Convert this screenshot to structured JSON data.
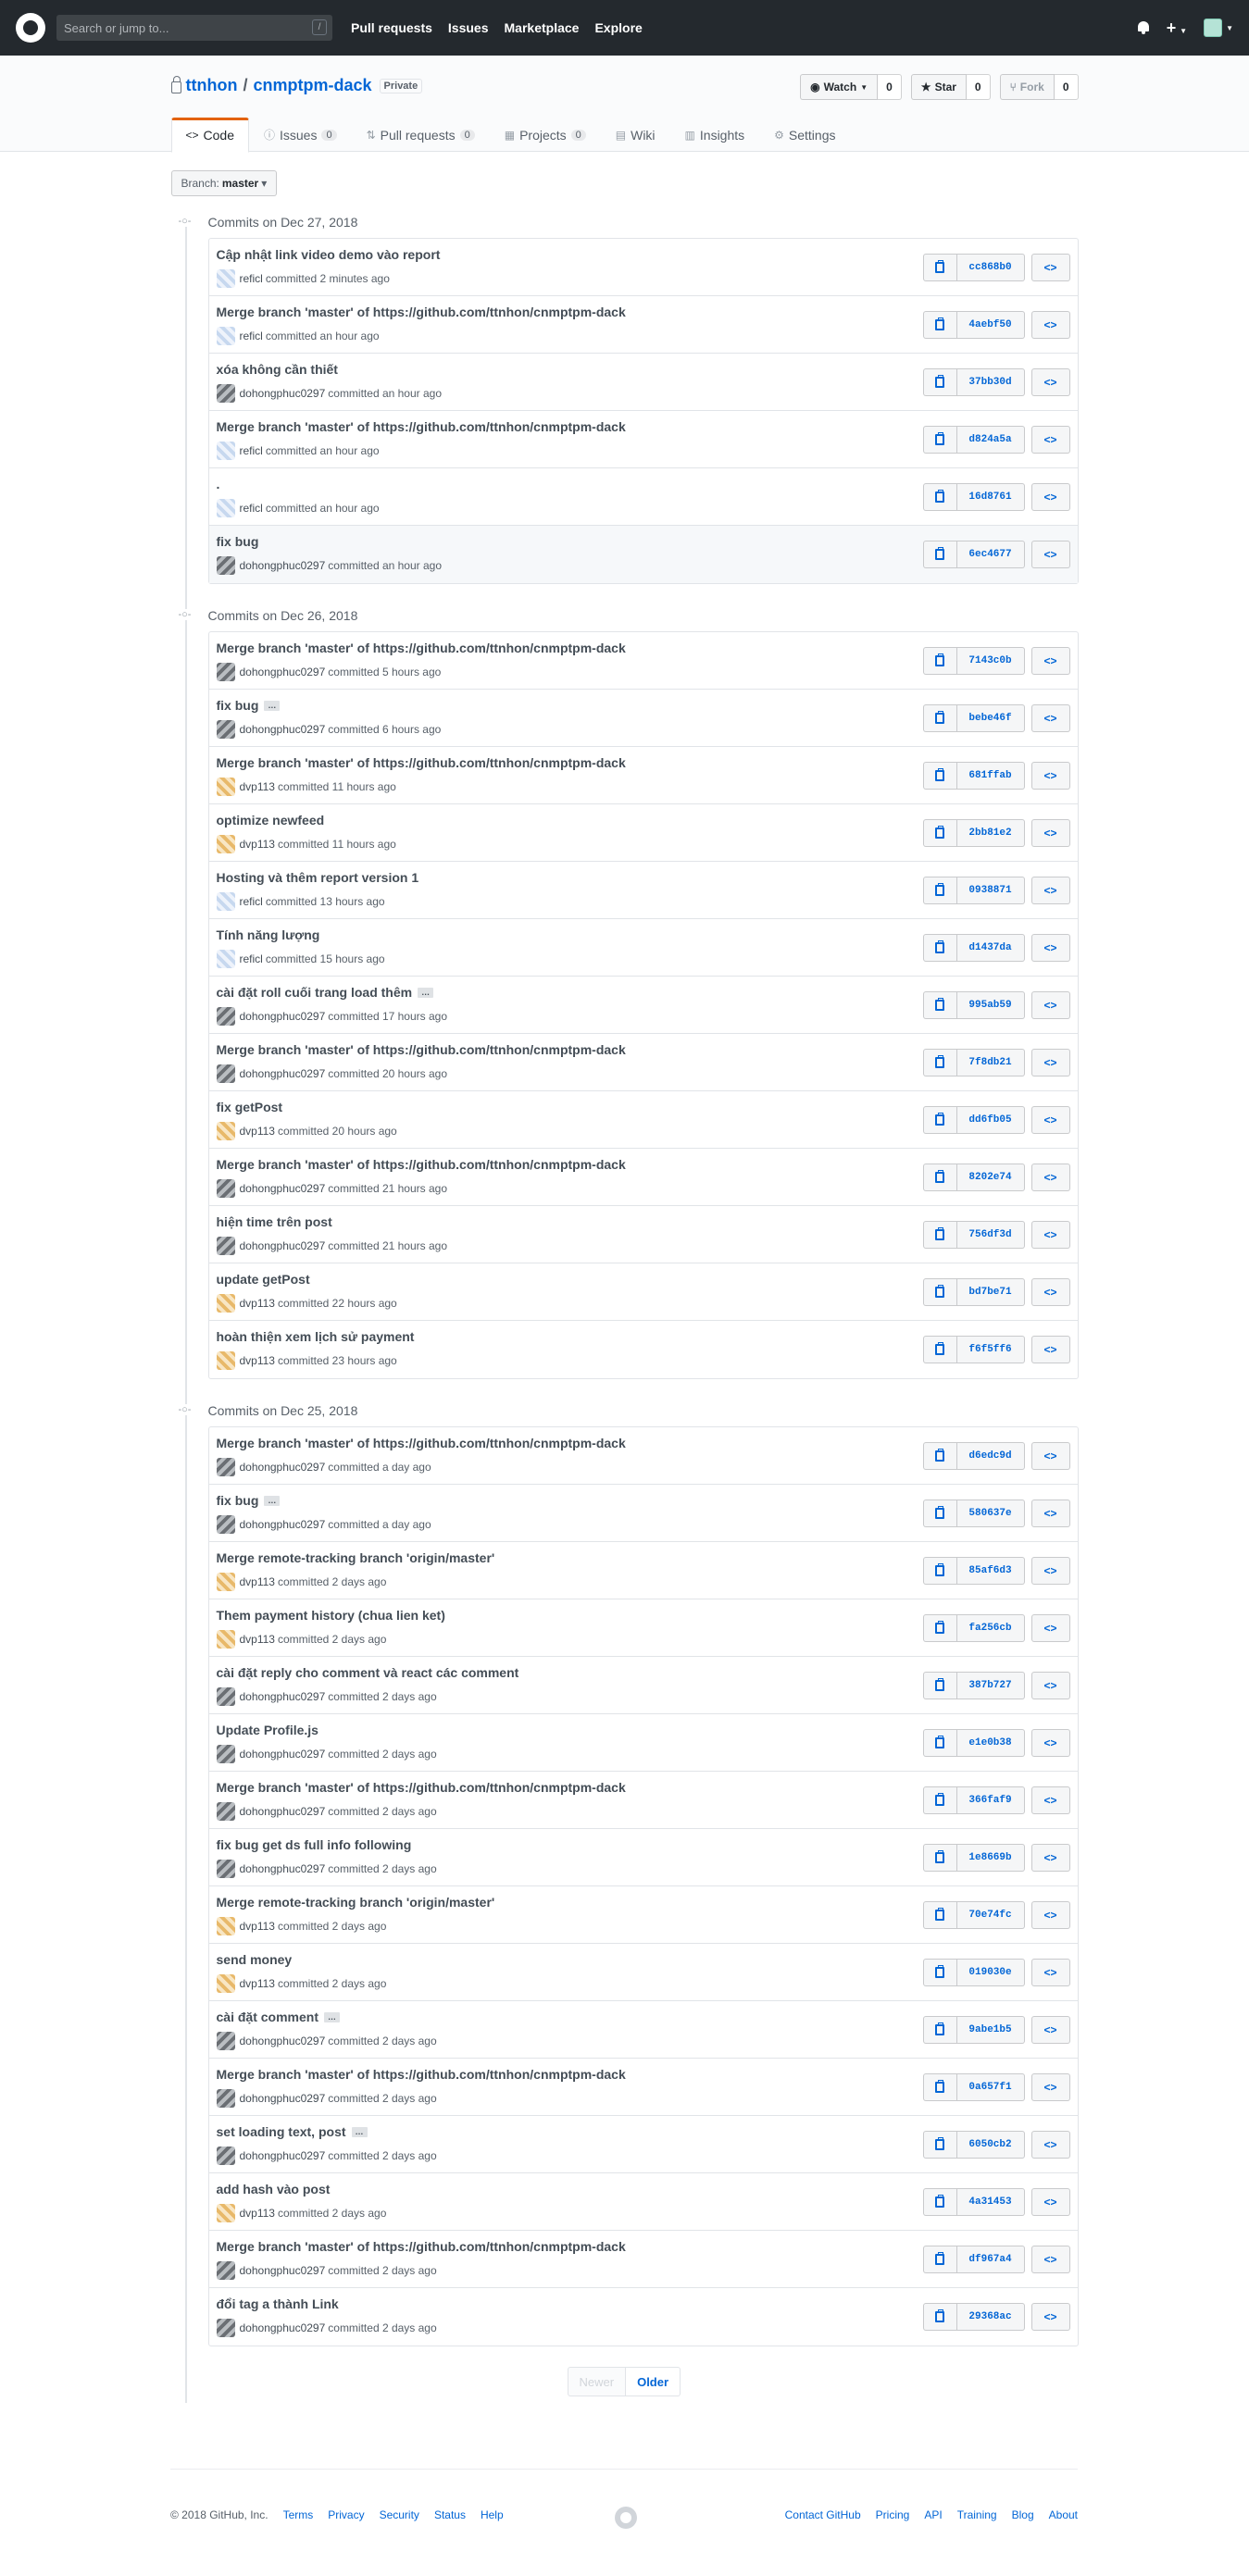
{
  "header": {
    "search_placeholder": "Search or jump to...",
    "search_key": "/",
    "nav": [
      "Pull requests",
      "Issues",
      "Marketplace",
      "Explore"
    ]
  },
  "repo": {
    "owner": "ttnhon",
    "separator": "/",
    "name": "cnmptpm-dack",
    "visibility": "Private",
    "watch_label": "Watch",
    "watch_count": "0",
    "star_label": "Star",
    "star_count": "0",
    "fork_label": "Fork",
    "fork_count": "0",
    "tabs": [
      {
        "label": "Code",
        "counter": null,
        "icon": "<>"
      },
      {
        "label": "Issues",
        "counter": "0",
        "icon": "ⓘ"
      },
      {
        "label": "Pull requests",
        "counter": "0",
        "icon": "⇅"
      },
      {
        "label": "Projects",
        "counter": "0",
        "icon": "▦"
      },
      {
        "label": "Wiki",
        "counter": null,
        "icon": "▤"
      },
      {
        "label": "Insights",
        "counter": null,
        "icon": "▥"
      },
      {
        "label": "Settings",
        "counter": null,
        "icon": "⚙"
      }
    ]
  },
  "branch": {
    "prefix": "Branch:",
    "name": "master"
  },
  "groups": [
    {
      "title": "Commits on Dec 27, 2018",
      "commits": [
        {
          "msg": "Cập nhật link video demo vào report",
          "author": "reficl",
          "time": "committed 2 minutes ago",
          "sha": "cc868b0",
          "av": "a",
          "more": false
        },
        {
          "msg": "Merge branch 'master' of https://github.com/ttnhon/cnmptpm-dack",
          "author": "reficl",
          "time": "committed an hour ago",
          "sha": "4aebf50",
          "av": "a",
          "more": false
        },
        {
          "msg": "xóa không cần thiết",
          "author": "dohongphuc0297",
          "time": "committed an hour ago",
          "sha": "37bb30d",
          "av": "b",
          "more": false
        },
        {
          "msg": "Merge branch 'master' of https://github.com/ttnhon/cnmptpm-dack",
          "author": "reficl",
          "time": "committed an hour ago",
          "sha": "d824a5a",
          "av": "a",
          "more": false
        },
        {
          "msg": ".",
          "author": "reficl",
          "time": "committed an hour ago",
          "sha": "16d8761",
          "av": "a",
          "more": false
        },
        {
          "msg": "fix bug",
          "author": "dohongphuc0297",
          "time": "committed an hour ago",
          "sha": "6ec4677",
          "av": "b",
          "more": false
        }
      ]
    },
    {
      "title": "Commits on Dec 26, 2018",
      "commits": [
        {
          "msg": "Merge branch 'master' of https://github.com/ttnhon/cnmptpm-dack",
          "author": "dohongphuc0297",
          "time": "committed 5 hours ago",
          "sha": "7143c0b",
          "av": "b",
          "more": false
        },
        {
          "msg": "fix bug",
          "author": "dohongphuc0297",
          "time": "committed 6 hours ago",
          "sha": "bebe46f",
          "av": "b",
          "more": true
        },
        {
          "msg": "Merge branch 'master' of https://github.com/ttnhon/cnmptpm-dack",
          "author": "dvp113",
          "time": "committed 11 hours ago",
          "sha": "681ffab",
          "av": "c",
          "more": false
        },
        {
          "msg": "optimize newfeed",
          "author": "dvp113",
          "time": "committed 11 hours ago",
          "sha": "2bb81e2",
          "av": "c",
          "more": false
        },
        {
          "msg": "Hosting và thêm report version 1",
          "author": "reficl",
          "time": "committed 13 hours ago",
          "sha": "0938871",
          "av": "a",
          "more": false
        },
        {
          "msg": "Tính năng lượng",
          "author": "reficl",
          "time": "committed 15 hours ago",
          "sha": "d1437da",
          "av": "a",
          "more": false
        },
        {
          "msg": "cài đặt roll cuối trang load thêm",
          "author": "dohongphuc0297",
          "time": "committed 17 hours ago",
          "sha": "995ab59",
          "av": "b",
          "more": true
        },
        {
          "msg": "Merge branch 'master' of https://github.com/ttnhon/cnmptpm-dack",
          "author": "dohongphuc0297",
          "time": "committed 20 hours ago",
          "sha": "7f8db21",
          "av": "b",
          "more": false
        },
        {
          "msg": "fix getPost",
          "author": "dvp113",
          "time": "committed 20 hours ago",
          "sha": "dd6fb05",
          "av": "c",
          "more": false
        },
        {
          "msg": "Merge branch 'master' of https://github.com/ttnhon/cnmptpm-dack",
          "author": "dohongphuc0297",
          "time": "committed 21 hours ago",
          "sha": "8202e74",
          "av": "b",
          "more": false
        },
        {
          "msg": "hiện time trên post",
          "author": "dohongphuc0297",
          "time": "committed 21 hours ago",
          "sha": "756df3d",
          "av": "b",
          "more": false
        },
        {
          "msg": "update getPost",
          "author": "dvp113",
          "time": "committed 22 hours ago",
          "sha": "bd7be71",
          "av": "c",
          "more": false
        },
        {
          "msg": "hoàn thiện xem lịch sử payment",
          "author": "dvp113",
          "time": "committed 23 hours ago",
          "sha": "f6f5ff6",
          "av": "c",
          "more": false
        }
      ]
    },
    {
      "title": "Commits on Dec 25, 2018",
      "commits": [
        {
          "msg": "Merge branch 'master' of https://github.com/ttnhon/cnmptpm-dack",
          "author": "dohongphuc0297",
          "time": "committed a day ago",
          "sha": "d6edc9d",
          "av": "b",
          "more": false
        },
        {
          "msg": "fix bug",
          "author": "dohongphuc0297",
          "time": "committed a day ago",
          "sha": "580637e",
          "av": "b",
          "more": true
        },
        {
          "msg": "Merge remote-tracking branch 'origin/master'",
          "author": "dvp113",
          "time": "committed 2 days ago",
          "sha": "85af6d3",
          "av": "c",
          "more": false
        },
        {
          "msg": "Them payment history (chua lien ket)",
          "author": "dvp113",
          "time": "committed 2 days ago",
          "sha": "fa256cb",
          "av": "c",
          "more": false
        },
        {
          "msg": "cài đặt reply cho comment và react các comment",
          "author": "dohongphuc0297",
          "time": "committed 2 days ago",
          "sha": "387b727",
          "av": "b",
          "more": false
        },
        {
          "msg": "Update Profile.js",
          "author": "dohongphuc0297",
          "time": "committed 2 days ago",
          "sha": "e1e0b38",
          "av": "b",
          "more": false
        },
        {
          "msg": "Merge branch 'master' of https://github.com/ttnhon/cnmptpm-dack",
          "author": "dohongphuc0297",
          "time": "committed 2 days ago",
          "sha": "366faf9",
          "av": "b",
          "more": false
        },
        {
          "msg": "fix bug get ds full info following",
          "author": "dohongphuc0297",
          "time": "committed 2 days ago",
          "sha": "1e8669b",
          "av": "b",
          "more": false
        },
        {
          "msg": "Merge remote-tracking branch 'origin/master'",
          "author": "dvp113",
          "time": "committed 2 days ago",
          "sha": "70e74fc",
          "av": "c",
          "more": false
        },
        {
          "msg": "send money",
          "author": "dvp113",
          "time": "committed 2 days ago",
          "sha": "019030e",
          "av": "c",
          "more": false
        },
        {
          "msg": "cài đặt comment",
          "author": "dohongphuc0297",
          "time": "committed 2 days ago",
          "sha": "9abe1b5",
          "av": "b",
          "more": true
        },
        {
          "msg": "Merge branch 'master' of https://github.com/ttnhon/cnmptpm-dack",
          "author": "dohongphuc0297",
          "time": "committed 2 days ago",
          "sha": "0a657f1",
          "av": "b",
          "more": false
        },
        {
          "msg": "set loading text, post",
          "author": "dohongphuc0297",
          "time": "committed 2 days ago",
          "sha": "6050cb2",
          "av": "b",
          "more": true
        },
        {
          "msg": "add hash vào post",
          "author": "dvp113",
          "time": "committed 2 days ago",
          "sha": "4a31453",
          "av": "c",
          "more": false
        },
        {
          "msg": "Merge branch 'master' of https://github.com/ttnhon/cnmptpm-dack",
          "author": "dohongphuc0297",
          "time": "committed 2 days ago",
          "sha": "df967a4",
          "av": "b",
          "more": false
        },
        {
          "msg": "đổi tag a thành Link",
          "author": "dohongphuc0297",
          "time": "committed 2 days ago",
          "sha": "29368ac",
          "av": "b",
          "more": false
        }
      ]
    }
  ],
  "pagination": {
    "newer": "Newer",
    "older": "Older"
  },
  "footer": {
    "copyright": "© 2018 GitHub, Inc.",
    "left_links": [
      "Terms",
      "Privacy",
      "Security",
      "Status",
      "Help"
    ],
    "right_links": [
      "Contact GitHub",
      "Pricing",
      "API",
      "Training",
      "Blog",
      "About"
    ]
  },
  "icons": {
    "browse": "<>",
    "ellipsis": "…",
    "caret": "▾"
  }
}
